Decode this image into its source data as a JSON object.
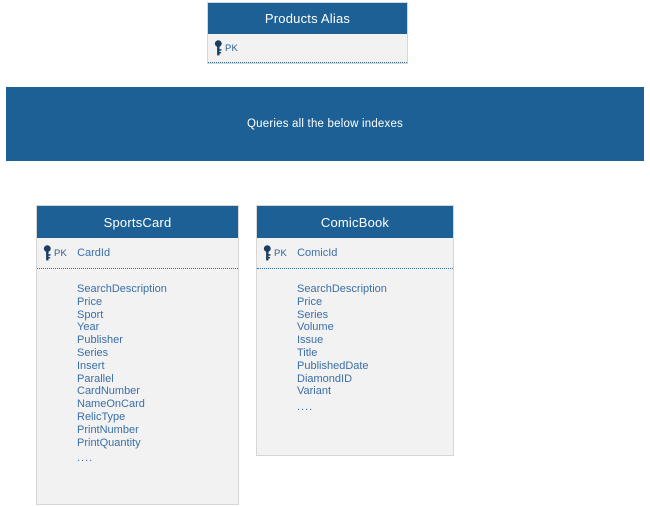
{
  "diagram": {
    "banner": {
      "text": "Queries all the below indexes",
      "color": "#1d6096",
      "text_color": "#ffffff"
    },
    "colors": {
      "header_blue": "#1d6096",
      "body_gray": "#f2f2f2",
      "field_text": "#3a6fa8",
      "key_icon": "#1b3f63",
      "border": "#d6d6d6",
      "separator": "#2b6ea8"
    },
    "entities": [
      {
        "id": "products-alias",
        "title": "Products Alias",
        "pk_label": "PK",
        "pk_field": "",
        "key_icon": "key-icon",
        "fields": []
      },
      {
        "id": "sportscard",
        "title": "SportsCard",
        "pk_label": "PK",
        "pk_field": "CardId",
        "key_icon": "key-icon",
        "fields": [
          "SearchDescription",
          "Price",
          "Sport",
          "Year",
          "Publisher",
          "Series",
          "Insert",
          "Parallel",
          "CardNumber",
          "NameOnCard",
          "RelicType",
          "PrintNumber",
          "PrintQuantity",
          "...."
        ]
      },
      {
        "id": "comicbook",
        "title": "ComicBook",
        "pk_label": "PK",
        "pk_field": "ComicId",
        "key_icon": "key-icon",
        "fields": [
          "SearchDescription",
          "Price",
          "Series",
          "Volume",
          "Issue",
          "Title",
          "PublishedDate",
          "DiamondID",
          "Variant",
          "...."
        ]
      }
    ]
  }
}
